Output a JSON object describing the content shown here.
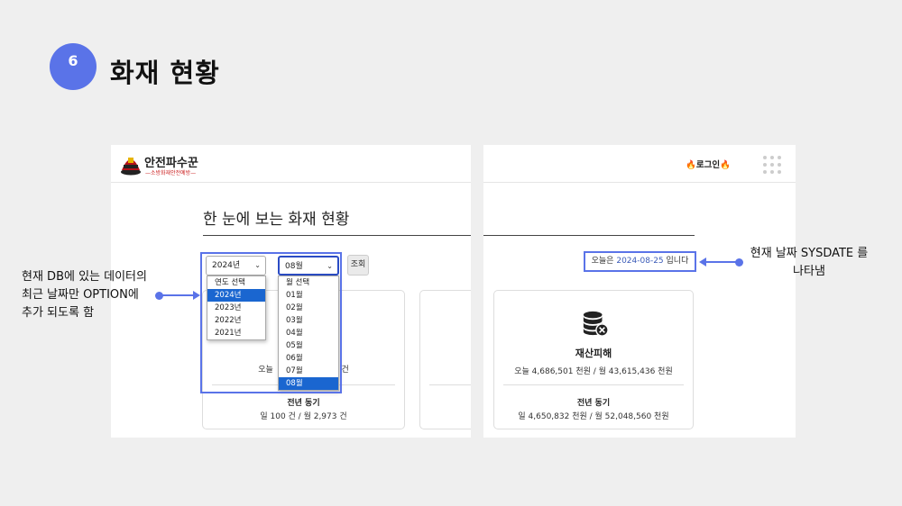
{
  "slide": {
    "number": "6",
    "title": "화재 현황"
  },
  "app": {
    "logo_name": "안전파수꾼",
    "logo_sub": "—소방화재안전예방—",
    "page_heading": "한 눈에 보는 화재 현황",
    "login_label": "로그인",
    "search_button": "조회"
  },
  "filters": {
    "year_value": "2024년",
    "month_value": "08월",
    "year_options": [
      "연도 선택",
      "2024년",
      "2023년",
      "2022년",
      "2021년"
    ],
    "year_selected": "2024년",
    "month_options": [
      "월 선택",
      "01월",
      "02월",
      "03월",
      "04월",
      "05월",
      "06월",
      "07월",
      "08월"
    ],
    "month_selected": "08월"
  },
  "today": {
    "prefix": "오늘은",
    "date": "2024-08-25",
    "suffix": "입니다"
  },
  "cards": {
    "left": {
      "today_prefix": "오늘",
      "today_suffix": "건",
      "prev_title": "전년 동기",
      "prev_line": "일 100 건 / 월 2,973 건"
    },
    "property": {
      "title": "재산피해",
      "today_line": "오늘 4,686,501 천원 / 월 43,615,436 천원",
      "prev_title": "전년 동기",
      "prev_line": "일 4,650,832 천원 / 월 52,048,560 천원"
    }
  },
  "annotations": {
    "left_lines": [
      "현재 DB에 있는 데이터의",
      "최근 날짜만 OPTION에",
      "추가 되도록 함"
    ],
    "right_lines": [
      "현재 날짜 SYSDATE 를",
      "나타냄"
    ]
  },
  "colors": {
    "accent": "#5a73e8",
    "selected": "#1a66d0"
  }
}
